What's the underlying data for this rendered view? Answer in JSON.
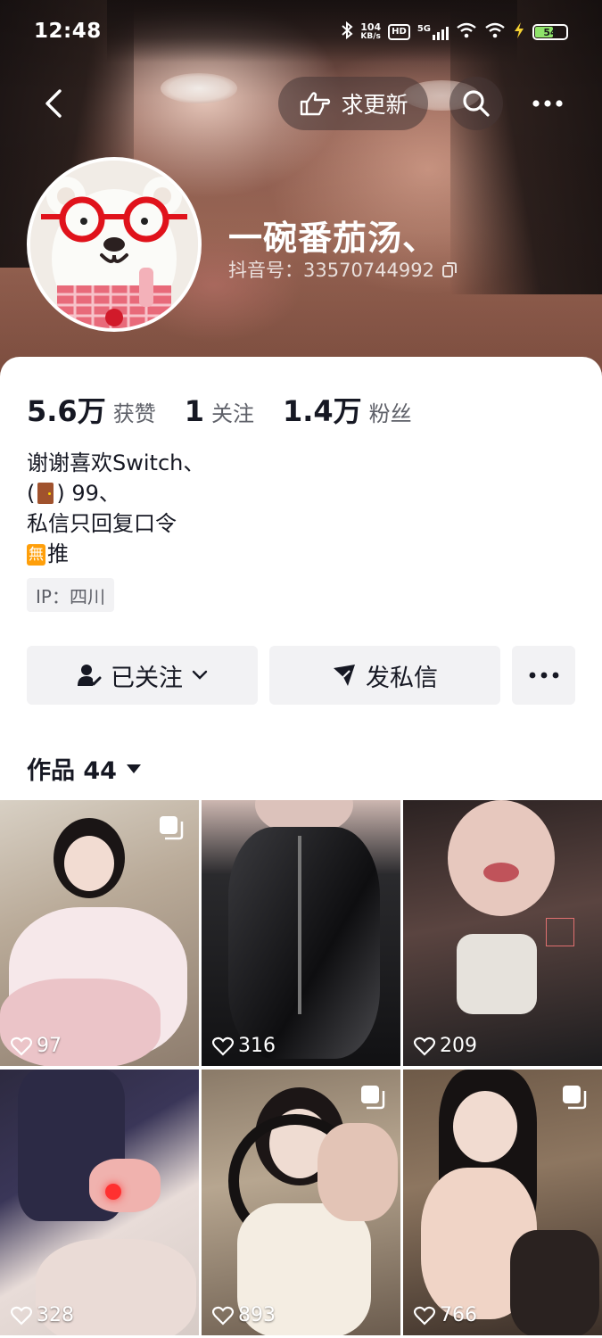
{
  "status_bar": {
    "time": "12:48",
    "net_speed_value": "104",
    "net_speed_unit": "KB/s",
    "hd": "HD",
    "network": "5G",
    "battery": "54"
  },
  "header": {
    "update_request_label": "求更新",
    "icons": [
      "back-arrow-icon",
      "pointing-hand-icon",
      "search-icon",
      "more-dots-icon"
    ]
  },
  "profile": {
    "nickname": "一碗番茄汤、",
    "douyin_id": "抖音号：33570744992"
  },
  "stats": [
    {
      "value": "5.6万",
      "label": "获赞"
    },
    {
      "value": "1",
      "label": "关注"
    },
    {
      "value": "1.4万",
      "label": "粉丝"
    }
  ],
  "bio": {
    "line1": "谢谢喜欢Switch、",
    "line2_prefix": "(",
    "line2_suffix": ") 99、",
    "line3": "私信只回复口令",
    "line4_badge": "無",
    "line4_text": "推"
  },
  "ip_location": "IP：四川",
  "actions": {
    "follow_label": "已关注",
    "message_label": "发私信"
  },
  "works_tab": {
    "label": "作品 44"
  },
  "videos": [
    {
      "likes": "97",
      "multi": true
    },
    {
      "likes": "316",
      "multi": false
    },
    {
      "likes": "209",
      "multi": false
    },
    {
      "likes": "328",
      "multi": false
    },
    {
      "likes": "893",
      "multi": true
    },
    {
      "likes": "766",
      "multi": true
    }
  ],
  "colors": {
    "text_primary": "#161823",
    "text_secondary": "#5e6068",
    "button_bg": "#f2f2f4",
    "battery_fill": "#8fe36a"
  }
}
